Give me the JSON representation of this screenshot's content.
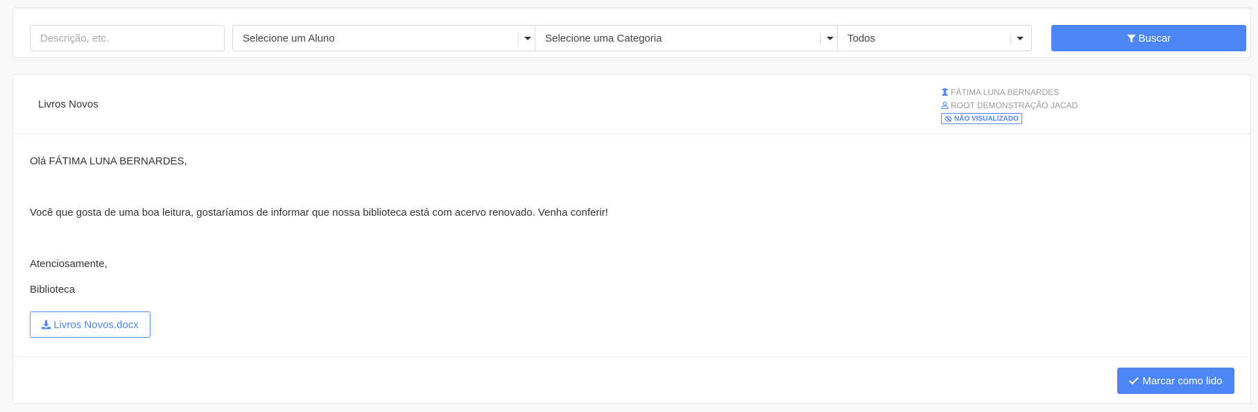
{
  "filters": {
    "description_placeholder": "Descrição, etc.",
    "student_select": "Selecione um Aluno",
    "category_select": "Selecione uma Categoria",
    "status_select": "Todos",
    "search_label": "Buscar"
  },
  "message": {
    "title": "Livros Novos",
    "student": "FÁTIMA LUNA BERNARDES",
    "sender": "ROOT DEMONSTRAÇÃO JACAD",
    "status_badge": "NÃO VISUALIZADO",
    "greeting": "Olá FÁTIMA LUNA BERNARDES,",
    "paragraph": "Você que gosta de uma boa leitura, gostaríamos de informar que nossa biblioteca está com acervo renovado. Venha conferir!",
    "closing": "Atenciosamente,",
    "signature": "Biblioteca",
    "attachment_label": "Livros Novos.docx",
    "mark_read_label": "Marcar como lido"
  },
  "icons": {
    "search_button": "filter-icon",
    "student": "graduate-icon",
    "sender": "user-icon",
    "badge": "eye-slash-icon",
    "attachment": "download-icon",
    "mark_read": "check-icon"
  },
  "colors": {
    "primary": "#4d86f7",
    "muted_text": "#9a9a9a",
    "background": "#f7f7f7"
  }
}
